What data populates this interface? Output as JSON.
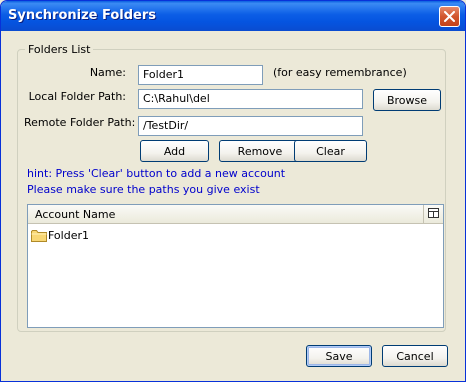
{
  "window": {
    "title": "Synchronize Folders"
  },
  "group": {
    "legend": "Folders List"
  },
  "form": {
    "name_label": "Name:",
    "name_value": "Folder1",
    "name_note": "(for easy remembrance)",
    "local_label": "Local Folder Path:",
    "local_value": "C:\\Rahul\\del",
    "remote_label": "Remote Folder Path:",
    "remote_value": "/TestDir/"
  },
  "buttons": {
    "browse": "Browse",
    "add": "Add",
    "remove": "Remove",
    "clear": "Clear",
    "save": "Save",
    "cancel": "Cancel"
  },
  "hints": [
    "hint: Press 'Clear' button to add a new account",
    "Please make sure the paths you give exist"
  ],
  "table": {
    "columns": [
      "Account Name"
    ],
    "rows": [
      "Folder1"
    ]
  },
  "icons": {
    "close": "close-icon",
    "folder": "folder-icon",
    "column_picker": "column-picker-icon"
  }
}
